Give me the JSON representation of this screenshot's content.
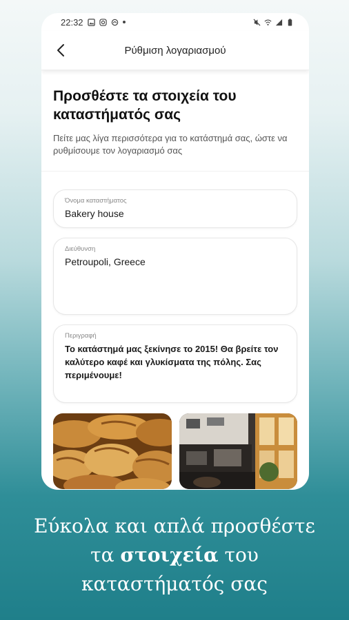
{
  "status_bar": {
    "time": "22:32",
    "icons": [
      "gallery-icon",
      "instagram-icon",
      "cloud-icon",
      "dot-icon"
    ],
    "right_icons": [
      "mute-icon",
      "wifi-icon",
      "signal-icon",
      "battery-icon"
    ]
  },
  "app_bar": {
    "title": "Ρύθμιση λογαριασμού",
    "back_icon": "chevron-left-icon"
  },
  "header": {
    "title": "Προσθέστε τα στοιχεία του καταστήματός σας",
    "subtitle": "Πείτε μας λίγα περισσότερα για το κατάστημά σας, ώστε να ρυθμίσουμε τον λογαριασμό σας"
  },
  "form": {
    "store_name": {
      "label": "Όνομα καταστήματος",
      "value": "Bakery house"
    },
    "address": {
      "label": "Διεύθυνση",
      "value": "Petroupoli, Greece"
    },
    "description": {
      "label": "Περιγραφή",
      "value": "Το κατάστημά μας ξεκίνησε το 2015! Θα βρείτε τον καλύτερο καφέ και γλυκίσματα της πόλης. Σας περιμένουμε!"
    }
  },
  "photos": [
    {
      "name": "croissants-photo"
    },
    {
      "name": "cafe-interior-photo"
    }
  ],
  "caption": {
    "line1": "Εύκολα και απλά προσθέστε",
    "line2_pre": "τα ",
    "line2_bold": "στοιχεία",
    "line2_post": " του",
    "line3": "καταστήματός σας"
  },
  "colors": {
    "accent_teal": "#1f7f8a",
    "card_bg": "#ffffff",
    "text_dark": "#111111"
  }
}
